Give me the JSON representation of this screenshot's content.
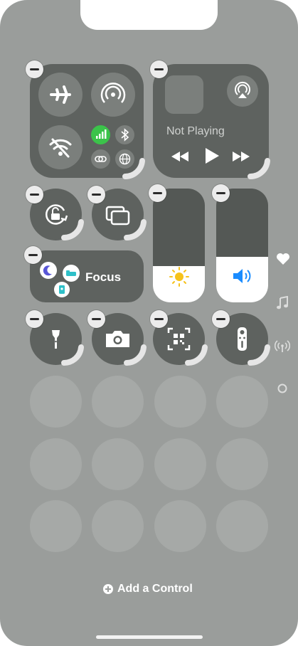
{
  "media": {
    "status": "Not Playing"
  },
  "focus": {
    "label": "Focus"
  },
  "footer": {
    "add_control_label": "Add a Control"
  },
  "controls": {
    "brightness_level": 0.32,
    "volume_level": 0.4
  },
  "colors": {
    "screen_bg": "#9a9d9b",
    "tile": "#5e625f",
    "ghost": "#a6a9a7",
    "cellular_green": "#3bc34a",
    "sun": "#f6c21b",
    "volume_blue": "#1a8cff",
    "moon": "#5856d6",
    "bed_teal": "#2fc0c8"
  },
  "side_pages": [
    "heart-icon",
    "music-note-icon",
    "antenna-icon",
    "circle-icon"
  ]
}
